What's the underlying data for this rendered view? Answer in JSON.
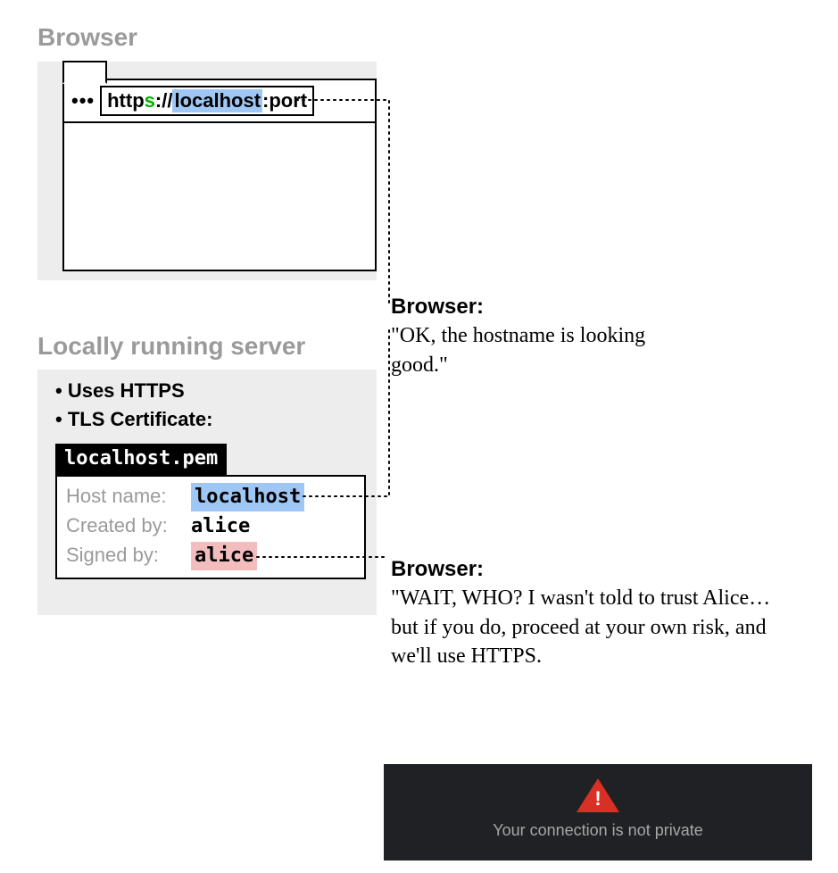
{
  "sections": {
    "browser_heading": "Browser",
    "server_heading": "Locally running server"
  },
  "browser": {
    "url": {
      "scheme_prefix": "http",
      "scheme_s": "s",
      "sep": "://",
      "host": "localhost",
      "port_sep": ":",
      "port": "port"
    }
  },
  "server": {
    "bullet1": "Uses HTTPS",
    "bullet2": "TLS Certificate:",
    "cert_file": "localhost.pem",
    "cert": {
      "hostname_label": "Host name:",
      "hostname_value": "localhost",
      "created_label": "Created by:",
      "created_value": "alice",
      "signed_label": "Signed by:",
      "signed_value": "alice"
    }
  },
  "notes": {
    "ok_title": "Browser:",
    "ok_body": "\"OK, the hostname is looking good.\"",
    "warn_title": "Browser:",
    "warn_body": "\"WAIT, WHO? I wasn't told to trust Alice… but if you do, proceed at your own risk, and we'll use HTTPS."
  },
  "warning": {
    "bang": "!",
    "message": "Your connection is not private"
  }
}
